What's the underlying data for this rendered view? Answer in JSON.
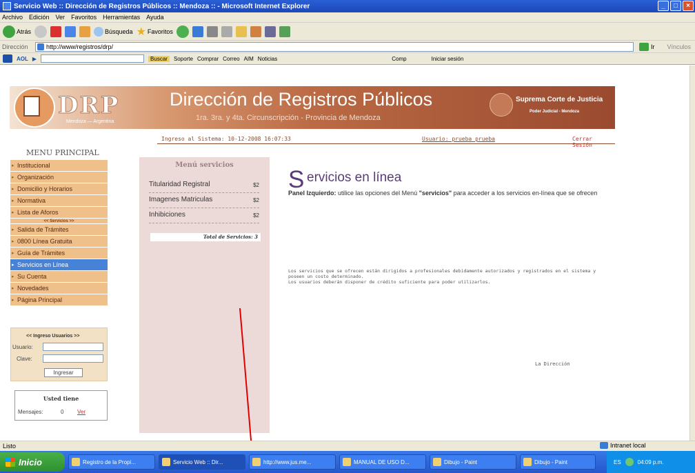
{
  "window": {
    "title": "Servicio Web :: Dirección de Registros Públicos :: Mendoza :: - Microsoft Internet Explorer"
  },
  "menubar": [
    "Archivo",
    "Edición",
    "Ver",
    "Favoritos",
    "Herramientas",
    "Ayuda"
  ],
  "toolbar": {
    "back_label": "Atrás",
    "search_label": "Búsqueda",
    "favorites_label": "Favoritos"
  },
  "address": {
    "label": "Dirección",
    "url": "http://www/registros/drp/",
    "go_label": "Ir",
    "links_label": "Vínculos"
  },
  "aolbar": {
    "brand": "AOL",
    "search_button": "Buscar",
    "items": [
      "Soporte",
      "Comprar",
      "Correo",
      "AIM",
      "Noticias",
      "Comp",
      "Iniciar sesión"
    ]
  },
  "header": {
    "logo_text": "DRP",
    "logo_sub": "Mendoza — Argentina",
    "title": "Dirección de Registros Públicos",
    "subtitle": "1ra. 3ra. y 4ta. Circunscripción - Provincia de Mendoza",
    "court": "Suprema Corte de Justicia",
    "court_sub": "Poder Judicial - Mendoza"
  },
  "info": {
    "login_time": "Ingreso al Sistema: 10-12-2008 16:07:33",
    "user": "Usuario: prueba prueba",
    "logout": "Cerrar Sesión"
  },
  "menu": {
    "title": "MENU PRINCIPAL",
    "items_top": [
      "Institucional",
      "Organización",
      "Domicilio y Horarios",
      "Normativa",
      "Lista de Aforos"
    ],
    "separator": "<< Servicios >>",
    "items_bottom": [
      "Salida de Trámites",
      "0800 Línea Gratuita",
      "Guía de Trámites",
      "Servicios en Línea",
      "Su Cuenta",
      "Novedades",
      "Página Principal"
    ]
  },
  "login": {
    "header": "<< Ingreso Usuarios >>",
    "user_label": "Usuario:",
    "pass_label": "Clave:",
    "button": "Ingresar"
  },
  "messages": {
    "header": "Usted tiene",
    "label": "Mensajes:",
    "count": "0",
    "link": "Ver"
  },
  "services": {
    "title": "Menú servicios",
    "rows": [
      {
        "label": "Titularidad Registral",
        "count": "$2"
      },
      {
        "label": "Imagenes Matriculas",
        "count": "$2"
      },
      {
        "label": "Inhibiciones",
        "count": "$2"
      }
    ],
    "total": "Total de Servicios: 3"
  },
  "main": {
    "heading_initial": "S",
    "heading_rest": "ervicios en línea",
    "panel_bold": "Panel Izquierdo:",
    "panel_text_1": " utilice las opciones del Menú ",
    "panel_quote": "\"servicios\"",
    "panel_text_2": " para acceder a los servicios en-línea que se ofrecen",
    "note_1": "Los servicios que se ofrecen están dirigidos a profesionales debidamente autorizados y registrados en el sistema y poseen un costo determinado.",
    "note_2": "Los usuarios deberán disponer de crédito suficiente para poder utilizarlos.",
    "signature": "La Dirección"
  },
  "status": {
    "left": "Listo",
    "zone": "Intranet local"
  },
  "taskbar": {
    "start": "Inicio",
    "tasks": [
      "Registro de la Propi...",
      "Servicio Web :: Dir...",
      "http://www.jus.me...",
      "MANUAL DE USO D...",
      "Dibujo - Paint",
      "Dibujo - Paint"
    ],
    "lang": "ES",
    "time": "04:09 p.m."
  },
  "colors": {
    "menu_item": "#efc08a",
    "menu_active": "#4682d8",
    "heading": "#5a3a7a",
    "annotation": "#e00000"
  }
}
